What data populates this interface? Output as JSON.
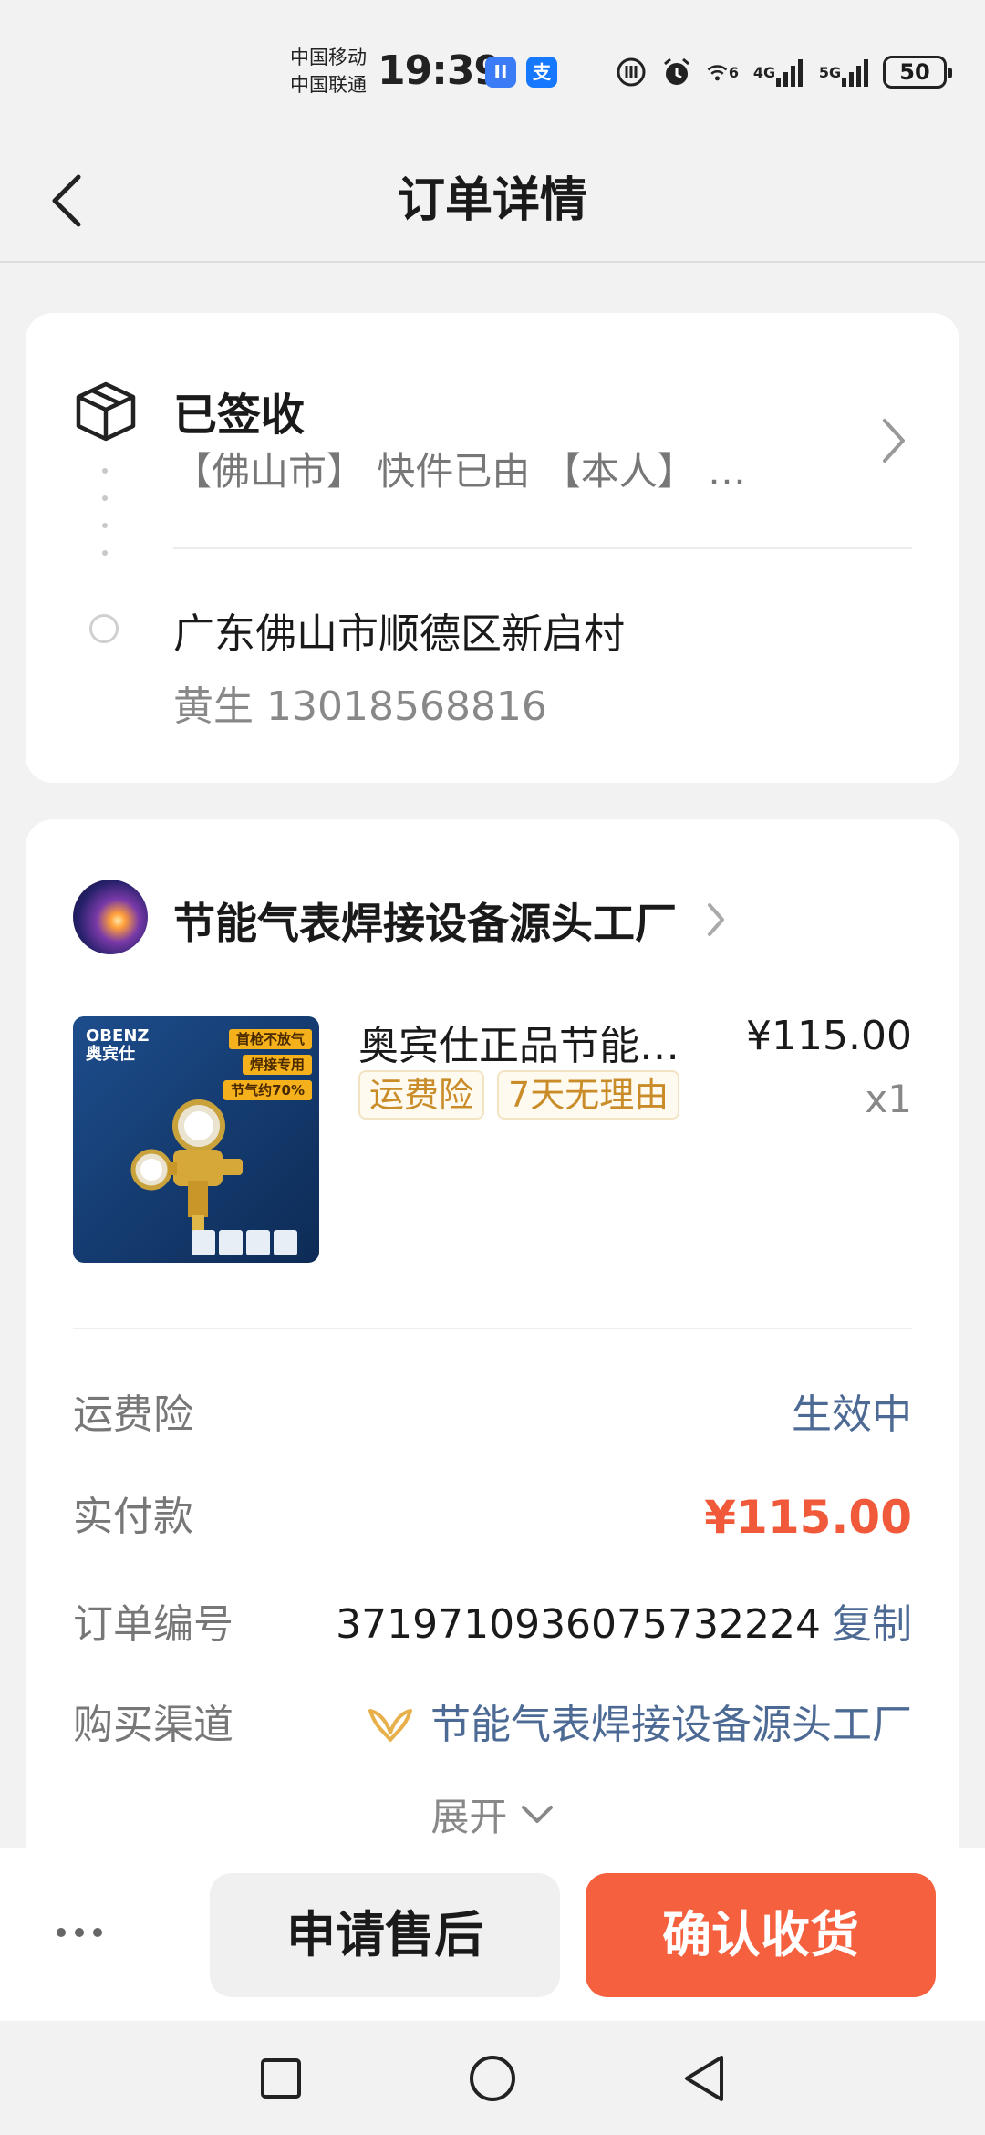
{
  "status_bar": {
    "carrier1": "中国移动",
    "carrier2": "中国联通",
    "time": "19:39",
    "app_badge1": "II",
    "app_badge2": "支",
    "wifi_label": "6",
    "sim1_label": "4G",
    "sim2_label": "5G",
    "battery": "50"
  },
  "header": {
    "title": "订单详情"
  },
  "logistics": {
    "status": "已签收",
    "detail": "【佛山市】 快件已由 【本人】 …",
    "address": "广东佛山市顺德区新启村",
    "contact": "黄生 13018568816"
  },
  "shop": {
    "name": "节能气表焊接设备源头工厂"
  },
  "product": {
    "title": "奥宾仕正品节能…",
    "price": "¥115.00",
    "quantity": "x1",
    "tags": [
      "运费险",
      "7天无理由"
    ],
    "image_text": {
      "brand": "OBENZ",
      "brand_cn": "奥宾仕",
      "tag1": "首枪不放气",
      "tag2": "焊接专用",
      "tag3": "节气约70%"
    }
  },
  "details": {
    "shipping_insurance_label": "运费险",
    "shipping_insurance_value": "生效中",
    "paid_label": "实付款",
    "paid_value": "¥115.00",
    "order_no_label": "订单编号",
    "order_no_value": "3719710936075732224",
    "copy_label": "复制",
    "channel_label": "购买渠道",
    "channel_value": "节能气表焊接设备源头工厂",
    "expand_label": "展开"
  },
  "actions": {
    "after_sales": "申请售后",
    "confirm": "确认收货"
  },
  "colors": {
    "accent": "#f5613e",
    "link": "#4d6a94",
    "tag": "#c98c28"
  }
}
